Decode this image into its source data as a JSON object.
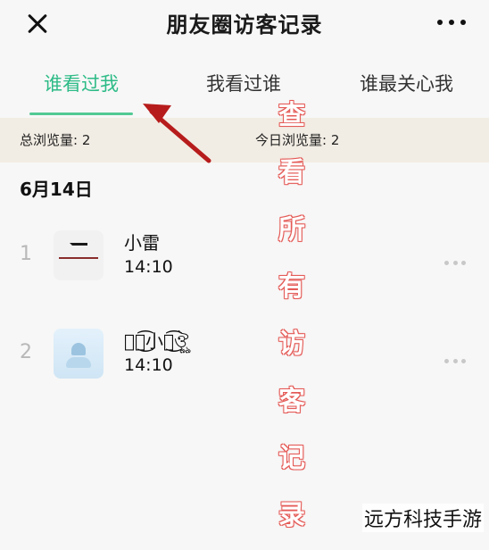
{
  "header": {
    "title": "朋友圈访客记录"
  },
  "tabs": [
    {
      "label": "谁看过我",
      "active": true
    },
    {
      "label": "我看过谁",
      "active": false
    },
    {
      "label": "谁最关心我",
      "active": false
    }
  ],
  "stats": {
    "total": "总浏览量: 2",
    "today": "今日浏览量: 2"
  },
  "date": "6月14日",
  "visitors": [
    {
      "index": "1",
      "name": "小雷",
      "time": "14:10"
    },
    {
      "index": "2",
      "name": "ঔৣ͜͡小花͜͡ঔৣ",
      "time": "14:10"
    }
  ],
  "overlay_text": [
    "查",
    "看",
    "所",
    "有",
    "访",
    "客",
    "记",
    "录"
  ],
  "watermark": "远方科技手游",
  "colors": {
    "accent": "#2dbb87",
    "stats_bg": "#f2ede4",
    "overlay_outline": "#e45b57",
    "arrow": "#b71c1c"
  }
}
